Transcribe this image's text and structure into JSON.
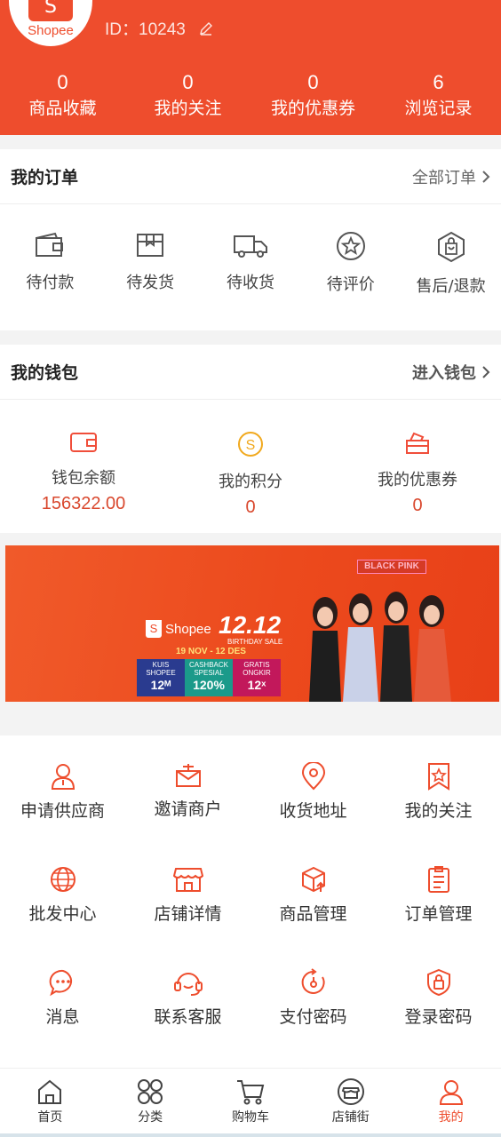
{
  "profile": {
    "brand": "Shopee",
    "id_text": "ID：10243"
  },
  "stats": [
    {
      "num": "0",
      "label": "商品收藏"
    },
    {
      "num": "0",
      "label": "我的关注"
    },
    {
      "num": "0",
      "label": "我的优惠券"
    },
    {
      "num": "6",
      "label": "浏览记录"
    }
  ],
  "orders": {
    "title": "我的订单",
    "more": "全部订单",
    "items": [
      "待付款",
      "待发货",
      "待收货",
      "待评价",
      "售后/退款"
    ]
  },
  "wallet": {
    "title": "我的钱包",
    "more": "进入钱包",
    "items": [
      {
        "label": "钱包余额",
        "value": "156322.00"
      },
      {
        "label": "我的积分",
        "value": "0"
      },
      {
        "label": "我的优惠券",
        "value": "0"
      }
    ]
  },
  "banner": {
    "tag": "BLACK PINK",
    "brand": "Shopee",
    "headline": "12.12",
    "sub": "BIRTHDAY SALE",
    "dates": "19 NOV - 12 DES",
    "promos": [
      {
        "top": "KUIS SHOPEE",
        "big": "12ᴹ"
      },
      {
        "top": "CASHBACK SPESIAL",
        "big": "120%"
      },
      {
        "top": "GRATIS ONGKIR",
        "big": "12ˣ"
      }
    ]
  },
  "services": [
    [
      "申请供应商",
      "邀请商户",
      "收货地址",
      "我的关注"
    ],
    [
      "批发中心",
      "店铺详情",
      "商品管理",
      "订单管理"
    ],
    [
      "消息",
      "联系客服",
      "支付密码",
      "登录密码"
    ]
  ],
  "tabbar": [
    "首页",
    "分类",
    "购物车",
    "店铺街",
    "我的"
  ],
  "colors": {
    "accent": "#ee4d2d",
    "value_red": "#d9482e",
    "wallet_icon": "#f04e3a",
    "coin_icon": "#f1a91e"
  }
}
